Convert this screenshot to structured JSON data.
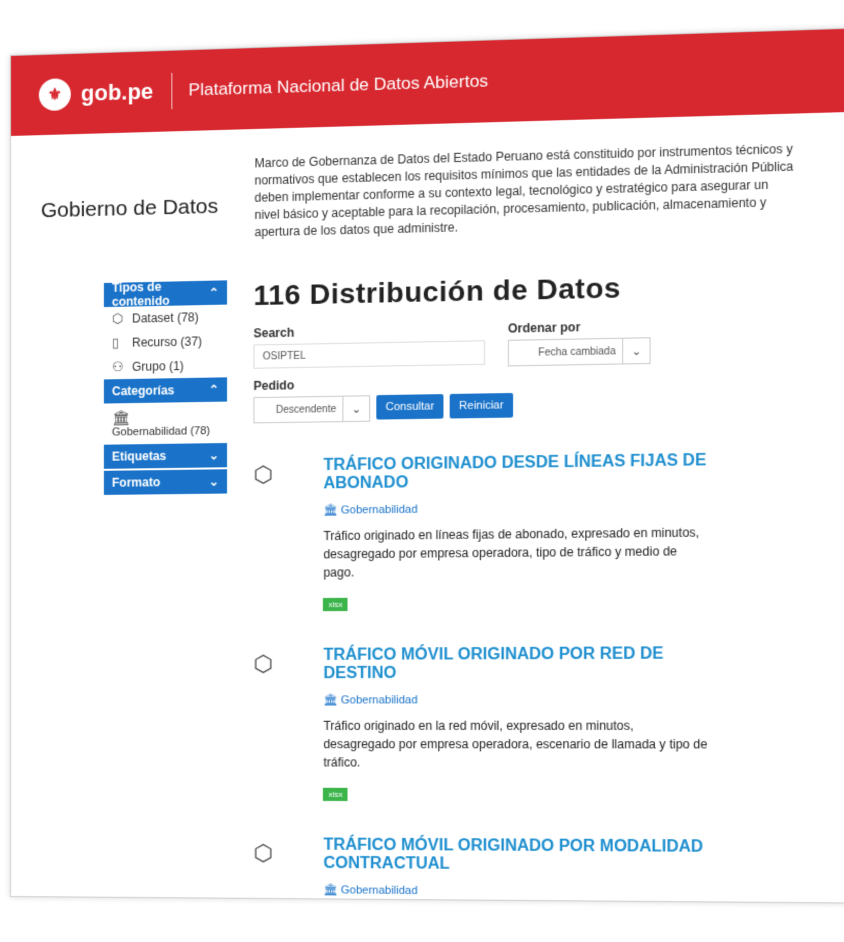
{
  "header": {
    "brand": "gob.pe",
    "platform_title": "Plataforma Nacional de Datos Abiertos"
  },
  "intro": {
    "title": "Gobierno de Datos",
    "text": "Marco de Gobernanza de Datos del Estado Peruano está constituido por instrumentos técnicos y normativos que establecen los requisitos mínimos que las entidades de la Administración Pública deben implementar conforme a su contexto legal, tecnológico y estratégico para asegurar un nivel básico y aceptable para la recopilación, procesamiento, publicación, almacenamiento y apertura de los datos que administre."
  },
  "sidebar": {
    "content_types_label": "Tipos de contenido",
    "content_types": [
      {
        "label": "Dataset (78)",
        "icon": "cube-icon"
      },
      {
        "label": "Recurso (37)",
        "icon": "file-icon"
      },
      {
        "label": "Grupo (1)",
        "icon": "group-icon"
      }
    ],
    "categories_label": "Categorías",
    "categories": [
      {
        "label": "Gobernabilidad (78)",
        "icon": "institution-icon"
      }
    ],
    "tags_label": "Etiquetas",
    "format_label": "Formato"
  },
  "main": {
    "heading": "116 Distribución de Datos",
    "search_label": "Search",
    "search_value": "OSIPTEL",
    "sort_label": "Ordenar por",
    "sort_value": "Fecha cambiada",
    "order_label": "Pedido",
    "order_value": "Descendente",
    "submit_label": "Consultar",
    "reset_label": "Reiniciar"
  },
  "results": [
    {
      "title": "TRÁFICO ORIGINADO DESDE LÍNEAS FIJAS DE ABONADO",
      "category": "Gobernabilidad",
      "description": "Tráfico originado en líneas fijas de abonado, expresado en minutos, desagregado por empresa operadora, tipo de tráfico y medio de pago.",
      "format": "xlsx"
    },
    {
      "title": "TRÁFICO MÓVIL ORIGINADO POR RED DE DESTINO",
      "category": "Gobernabilidad",
      "description": "Tráfico originado en la red móvil, expresado en minutos, desagregado por empresa operadora, escenario de llamada y tipo de tráfico.",
      "format": "xlsx"
    },
    {
      "title": "TRÁFICO MÓVIL ORIGINADO POR MODALIDAD CONTRACTUAL",
      "category": "Gobernabilidad",
      "description": "",
      "format": ""
    }
  ]
}
